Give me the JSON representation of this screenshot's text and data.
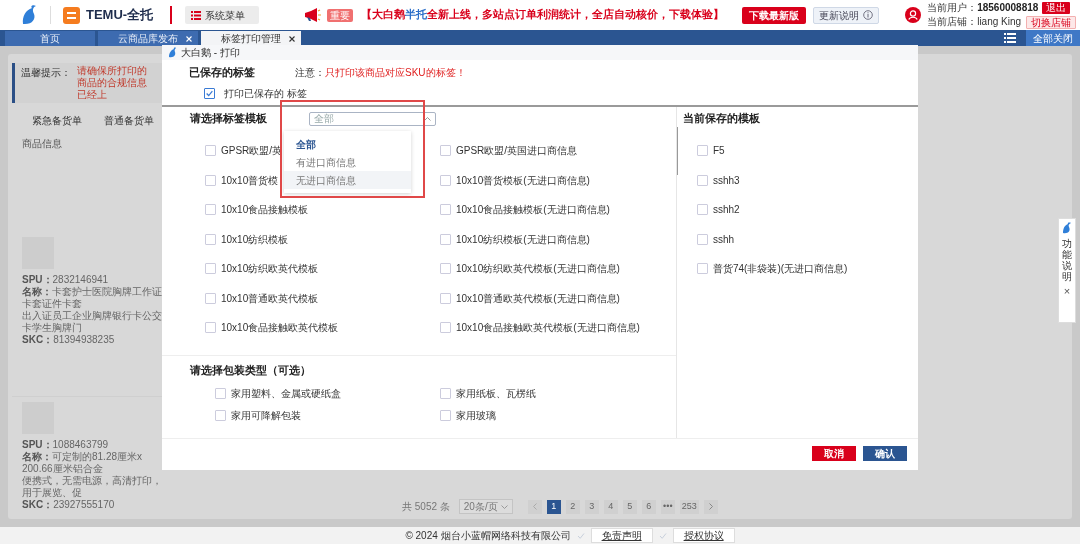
{
  "header": {
    "brand": "TEMU-全托",
    "menu_button": "系统菜单",
    "notice_badge": "重要",
    "announcement": [
      {
        "text": "【大白鹅",
        "accent": false
      },
      {
        "text": "半托",
        "accent": true
      },
      {
        "text": "全新上线，多站点订单利润统计，全店自动核价，下载体验】",
        "accent": false
      }
    ],
    "download_button": "下载最新版",
    "update_button": "更新说明",
    "user_label": "当前用户：",
    "user_value": "18560008818",
    "logout_button": "退出",
    "shop_label": "当前店铺：",
    "shop_value": "liang King",
    "switch_shop_button": "切换店铺"
  },
  "tabs": [
    {
      "label": "首页",
      "closable": false,
      "selected": false
    },
    {
      "label": "云商品库发布",
      "closable": true,
      "selected": false
    },
    {
      "label": "标签打印管理",
      "closable": true,
      "selected": true
    }
  ],
  "close_all_button": "全部关闭",
  "page": {
    "tip_label": "温馨提示：",
    "tip_text": "请确保所打印的商品的合规信息已经上",
    "order_tabs": [
      "紧急备货单",
      "普通备货单"
    ],
    "column_header": "商品信息",
    "products": [
      {
        "spu_label": "SPU：",
        "spu": "2832146941",
        "name_label": "名称：",
        "name_lines": [
          "卡套护士医院胸牌工作证卡套证件卡套",
          "出入证员工企业胸牌银行卡公交卡学生胸牌门"
        ],
        "skc_label": "SKC：",
        "skc": "81394938235"
      },
      {
        "spu_label": "SPU：",
        "spu": "1088463799",
        "name_label": "名称：",
        "name_lines": [
          "可定制的81.28厘米x 200.66厘米铝合金",
          "便携式，无需电源，高清打印，用于展览、促"
        ],
        "skc_label": "SKC：",
        "skc": "23927555170"
      }
    ],
    "pagination": {
      "total": "共 5052 条",
      "page_size": "20条/页",
      "pages": [
        {
          "label": "1",
          "selected": true
        },
        {
          "label": "2",
          "selected": false
        },
        {
          "label": "3",
          "selected": false
        },
        {
          "label": "4",
          "selected": false
        },
        {
          "label": "5",
          "selected": false
        },
        {
          "label": "6",
          "selected": false
        },
        {
          "label": "•••",
          "selected": false
        },
        {
          "label": "253",
          "selected": false
        }
      ]
    }
  },
  "footer": {
    "copyright": "© 2024 烟台小蓝帽网络科技有限公司",
    "links": [
      "免责声明",
      "授权协议"
    ]
  },
  "dialog": {
    "title": "大白鹅 - 打印",
    "saved_heading": "已保存的标签",
    "note_label": "注意：",
    "note_text": "只打印该商品对应SKU的标签！",
    "print_saved": {
      "label": "打印已保存的 标签",
      "checked": true
    },
    "template_heading": "请选择标签模板",
    "template_select": {
      "placeholder": "全部",
      "expanded": true,
      "highlighted": true,
      "options": [
        {
          "label": "全部",
          "selected": true,
          "hovered": false
        },
        {
          "label": "有进口商信息",
          "selected": false,
          "hovered": false
        },
        {
          "label": "无进口商信息",
          "selected": false,
          "hovered": true
        }
      ]
    },
    "templates": [
      {
        "label": "GPSR欧盟/英",
        "checked": false
      },
      {
        "label": "GPSR欧盟/英国进口商信息",
        "checked": false
      },
      {
        "label": "10x10普货模",
        "checked": false
      },
      {
        "label": "10x10普货模板(无进口商信息)",
        "checked": false
      },
      {
        "label": "10x10食品接触模板",
        "checked": false
      },
      {
        "label": "10x10食品接触模板(无进口商信息)",
        "checked": false
      },
      {
        "label": "10x10纺织模板",
        "checked": false
      },
      {
        "label": "10x10纺织模板(无进口商信息)",
        "checked": false
      },
      {
        "label": "10x10纺织欧英代模板",
        "checked": false
      },
      {
        "label": "10x10纺织欧英代模板(无进口商信息)",
        "checked": false
      },
      {
        "label": "10x10普通欧英代模板",
        "checked": false
      },
      {
        "label": "10x10普通欧英代模板(无进口商信息)",
        "checked": false
      },
      {
        "label": "10x10食品接触欧英代模板",
        "checked": false
      },
      {
        "label": "10x10食品接触欧英代模板(无进口商信息)",
        "checked": false
      }
    ],
    "package_heading": "请选择包装类型（可选）",
    "packages": [
      {
        "label": "家用塑料、金属或硬纸盒",
        "checked": false
      },
      {
        "label": "家用纸板、瓦楞纸",
        "checked": false
      },
      {
        "label": "家用可降解包装",
        "checked": false
      },
      {
        "label": "家用玻璃",
        "checked": false
      }
    ],
    "saved_templates_heading": "当前保存的模板",
    "saved_templates": [
      {
        "label": "F5",
        "checked": false
      },
      {
        "label": "sshh3",
        "checked": false
      },
      {
        "label": "sshh2",
        "checked": false
      },
      {
        "label": "sshh",
        "checked": false
      },
      {
        "label": "普货74(非袋装)(无进口商信息)",
        "checked": false
      }
    ],
    "cancel_button": "取消",
    "confirm_button": "确认"
  },
  "help_panel": {
    "label": "功能说明",
    "close": "×"
  }
}
